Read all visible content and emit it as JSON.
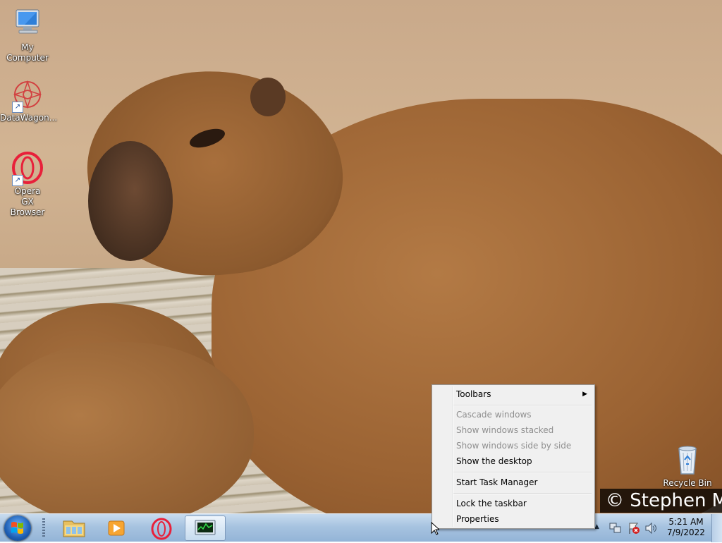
{
  "desktop": {
    "icons": [
      {
        "label": "My Computer",
        "icon": "computer-icon"
      },
      {
        "label": "DataWagon...",
        "icon": "datawagon-icon"
      },
      {
        "label": "Opera GX Browser",
        "icon": "opera-gx-icon"
      },
      {
        "label": "Recycle Bin",
        "icon": "recycle-bin-icon"
      }
    ],
    "wallpaper_credit": "© Stephen Me"
  },
  "context_menu": {
    "items": [
      {
        "label": "Toolbars",
        "enabled": true,
        "submenu": true
      },
      {
        "label": "Cascade windows",
        "enabled": false
      },
      {
        "label": "Show windows stacked",
        "enabled": false
      },
      {
        "label": "Show windows side by side",
        "enabled": false
      },
      {
        "label": "Show the desktop",
        "enabled": true
      },
      {
        "label": "Start Task Manager",
        "enabled": true
      },
      {
        "label": "Lock the taskbar",
        "enabled": true
      },
      {
        "label": "Properties",
        "enabled": true
      }
    ],
    "submenu_arrow": "▶"
  },
  "taskbar": {
    "pinned": [
      "windows-explorer-icon",
      "media-player-icon",
      "opera-gx-icon",
      "task-manager-icon"
    ],
    "tray_icons": [
      "show-hidden-icons-chevron",
      "network-icon",
      "action-center-flag-icon",
      "volume-icon"
    ],
    "clock": {
      "time": "5:21 AM",
      "date": "7/9/2022"
    }
  },
  "colors": {
    "taskbar_top": "#c9dcef",
    "taskbar_bottom": "#93b4d7",
    "menu_bg": "#f0f0f0",
    "disabled_text": "#8f8f8f"
  }
}
